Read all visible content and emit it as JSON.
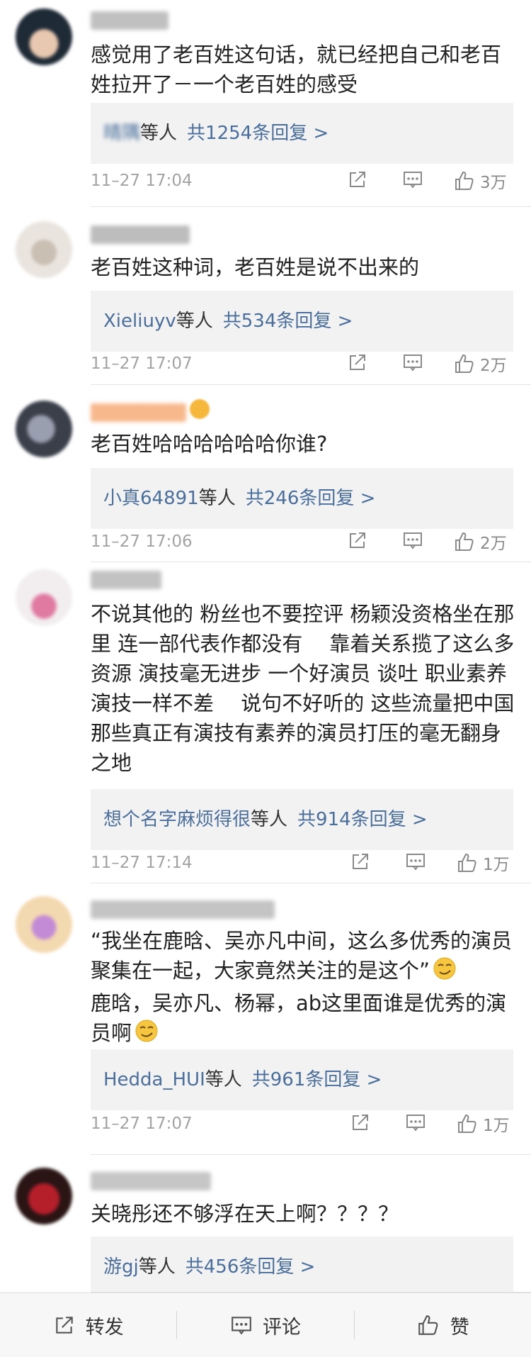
{
  "comments": [
    {
      "text": "感觉用了老百姓这句话，就已经把自己和老百姓拉开了－一个老百姓的感受",
      "reply_users": "晴隅",
      "reply_suffix": "等人",
      "reply_count": "共1254条回复 >",
      "timestamp": "11–27 17:04",
      "likes": "3万",
      "avatar_colors": [
        "#1e2a35",
        "#e8c8b0"
      ],
      "username_color": "#c0c0c0",
      "vip": false
    },
    {
      "text": "老百姓这种词，老百姓是说不出来的",
      "reply_users": "Xieliuyv",
      "reply_suffix": "等人",
      "reply_count": "共534条回复 >",
      "timestamp": "11–27 17:07",
      "likes": "2万",
      "avatar_colors": [
        "#e9e4de",
        "#c9bfb3"
      ],
      "username_color": "#bdbdbd",
      "vip": false
    },
    {
      "text": "老百姓哈哈哈哈哈哈你谁?",
      "reply_users": "小真64891",
      "reply_suffix": "等人",
      "reply_count": "共246条回复 >",
      "timestamp": "11–27 17:06",
      "likes": "2万",
      "avatar_colors": [
        "#3a3f4a",
        "#9a9fb0"
      ],
      "username_color": "#f7b98c",
      "vip": true
    },
    {
      "text": "不说其他的 粉丝也不要控评 杨颖没资格坐在那里 连一部代表作都没有　 靠着关系揽了这么多资源 演技毫无进步 一个好演员 谈吐 职业素养 演技一样不差　 说句不好听的 这些流量把中国那些真正有演技有素养的演员打压的毫无翻身之地",
      "reply_users": "想个名字麻烦得很",
      "reply_suffix": "等人",
      "reply_count": "共914条回复 >",
      "timestamp": "11–27 17:14",
      "likes": "1万",
      "avatar_colors": [
        "#f2eef0",
        "#e07aa0"
      ],
      "username_color": "#c2c2c2",
      "vip": false
    },
    {
      "text_parts": [
        "“我坐在鹿晗、吴亦凡中间，这么多优秀的演员聚集在一起，大家竟然关注的是这个”",
        "鹿晗，吴亦凡、杨幂，ab这里面谁是优秀的演员啊"
      ],
      "reply_users": "Hedda_HUI",
      "reply_suffix": "等人",
      "reply_count": "共961条回复 >",
      "timestamp": "11–27 17:07",
      "likes": "1万",
      "avatar_colors": [
        "#f3d9b0",
        "#c38ad6"
      ],
      "username_color": "#c4c4c4",
      "vip": false
    },
    {
      "text": "关晓彤还不够浮在天上啊？？？？",
      "reply_users": "游gj",
      "reply_suffix": "等人",
      "reply_count": "共456条回复 >",
      "avatar_colors": [
        "#2a1414",
        "#b51f2a"
      ],
      "username_color": "#c6c6c6",
      "vip": false
    }
  ],
  "bottom_bar": {
    "repost_label": "转发",
    "comment_label": "评论",
    "like_label": "赞"
  },
  "icons": {
    "share": "share-arrow-icon",
    "comment": "comment-bubble-icon",
    "like": "thumbs-up-icon",
    "emoji": "smirk-emoji-icon"
  },
  "colors": {
    "link": "#4a6f9c",
    "reply_bg": "#f2f2f2",
    "meta": "#a3a3a3"
  }
}
